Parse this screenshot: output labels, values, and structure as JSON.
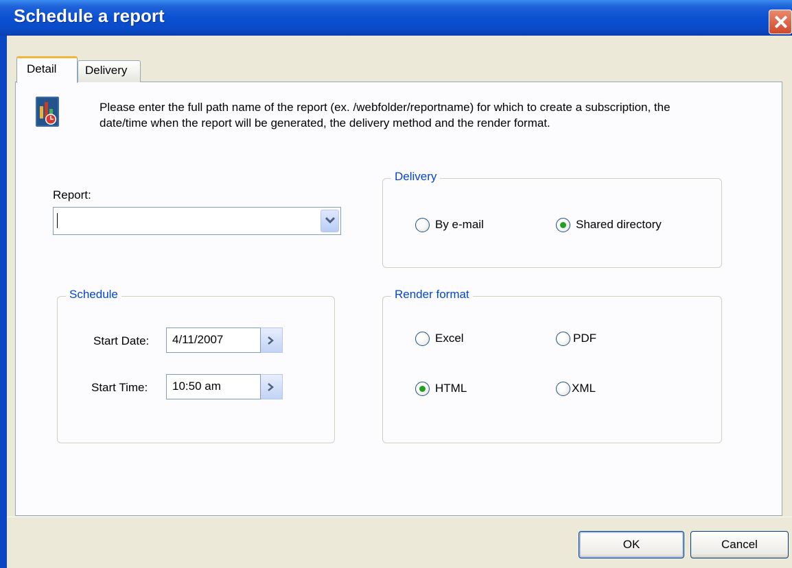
{
  "window": {
    "title": "Schedule a report",
    "close_icon": "close-icon"
  },
  "tabs": [
    {
      "label": "Detail",
      "selected": true
    },
    {
      "label": "Delivery",
      "selected": false
    }
  ],
  "instructions": "Please enter the full path name of the report (ex. /webfolder/reportname) for which to create a subscription, the date/time when the report will be generated, the delivery method and the render format.",
  "report": {
    "label": "Report:",
    "value": ""
  },
  "schedule": {
    "title": "Schedule",
    "start_date_label": "Start Date:",
    "start_date": "4/11/2007",
    "start_time_label": "Start Time:",
    "start_time": "10:50 am"
  },
  "delivery": {
    "title": "Delivery",
    "options": [
      {
        "label": "By e-mail",
        "checked": false
      },
      {
        "label": "Shared directory",
        "checked": true
      }
    ]
  },
  "render_format": {
    "title": "Render format",
    "options": [
      {
        "label": "Excel",
        "checked": false
      },
      {
        "label": "PDF",
        "checked": false
      },
      {
        "label": "HTML",
        "checked": true
      },
      {
        "label": "XML",
        "checked": false
      }
    ]
  },
  "buttons": {
    "ok": "OK",
    "cancel": "Cancel"
  },
  "colors": {
    "titlebar": "#0a4bc8",
    "group_title": "#0046d5",
    "radio_check": "#21a121",
    "tab_accent": "#f4b538"
  }
}
